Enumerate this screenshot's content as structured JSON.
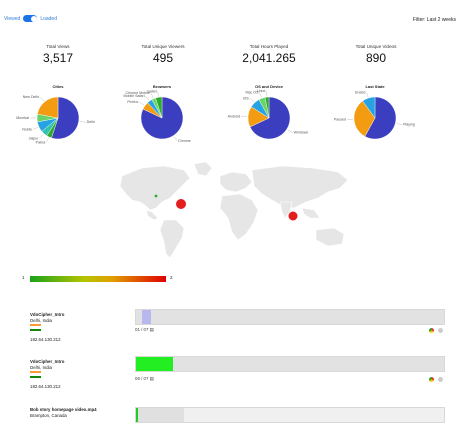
{
  "toolbar": {
    "viewed_label": "Viewed",
    "loaded_label": "Loaded",
    "filter_text": "Filter: Last 2 weeks"
  },
  "stats": [
    {
      "label": "Total Views",
      "value": "3,517"
    },
    {
      "label": "Total Unique Viewers",
      "value": "495"
    },
    {
      "label": "Total Hours Played",
      "value": "2,041.265"
    },
    {
      "label": "Total Unique Videos",
      "value": "890"
    }
  ],
  "pies": [
    {
      "title": "Cities",
      "slices": [
        {
          "label": "Delhi",
          "value": 55,
          "color": "#3b3fbf"
        },
        {
          "label": "Patna",
          "value": 4,
          "color": "#2eaa2e"
        },
        {
          "label": "Jaipur",
          "value": 5,
          "color": "#32c2b0"
        },
        {
          "label": "Noida",
          "value": 8,
          "color": "#27a3e3"
        },
        {
          "label": "Mumbai",
          "value": 6,
          "color": "#6ad36a"
        },
        {
          "label": "New Delhi",
          "value": 22,
          "color": "#f39c12"
        }
      ]
    },
    {
      "title": "Browsers",
      "slices": [
        {
          "label": "Chrome",
          "value": 82,
          "color": "#3b3fbf"
        },
        {
          "label": "Firefox",
          "value": 6,
          "color": "#f39c12"
        },
        {
          "label": "Mobile Safari",
          "value": 4,
          "color": "#27a3e3"
        },
        {
          "label": "Chrome Mobile",
          "value": 3,
          "color": "#6ad36a"
        },
        {
          "label": "Safari",
          "value": 5,
          "color": "#2eaa2e"
        }
      ]
    },
    {
      "title": "OS and Device",
      "slices": [
        {
          "label": "Windows",
          "value": 68,
          "color": "#3b3fbf"
        },
        {
          "label": "Android",
          "value": 16,
          "color": "#f39c12"
        },
        {
          "label": "iOS",
          "value": 8,
          "color": "#27a3e3"
        },
        {
          "label": "Mac OS",
          "value": 5,
          "color": "#6ad36a"
        },
        {
          "label": "Linux",
          "value": 3,
          "color": "#2eaa2e"
        }
      ]
    },
    {
      "title": "Last State",
      "slices": [
        {
          "label": "Playing",
          "value": 58,
          "color": "#3b3fbf"
        },
        {
          "label": "Paused",
          "value": 32,
          "color": "#f39c12"
        },
        {
          "label": "Ended",
          "value": 10,
          "color": "#27a3e3"
        }
      ]
    }
  ],
  "map": {
    "legend_min": "1",
    "legend_max": "2"
  },
  "sessions": [
    {
      "title": "VdoCipher_Intro",
      "location": "Delhi, India",
      "ip": "182.64.130.212",
      "position": "01 / 07",
      "progress": 0.03,
      "color": "#b8b8ee"
    },
    {
      "title": "VdoCipher_Intro",
      "location": "Delhi, India",
      "ip": "182.64.130.212",
      "position": "06 / 07",
      "progress": 0.12,
      "color": "#22ee22"
    },
    {
      "title": "Bob story homepage video.mp4",
      "location": "Brampton, Canada",
      "ip": "",
      "position": "",
      "progress": 0.15,
      "color": "#22cc22"
    }
  ]
}
